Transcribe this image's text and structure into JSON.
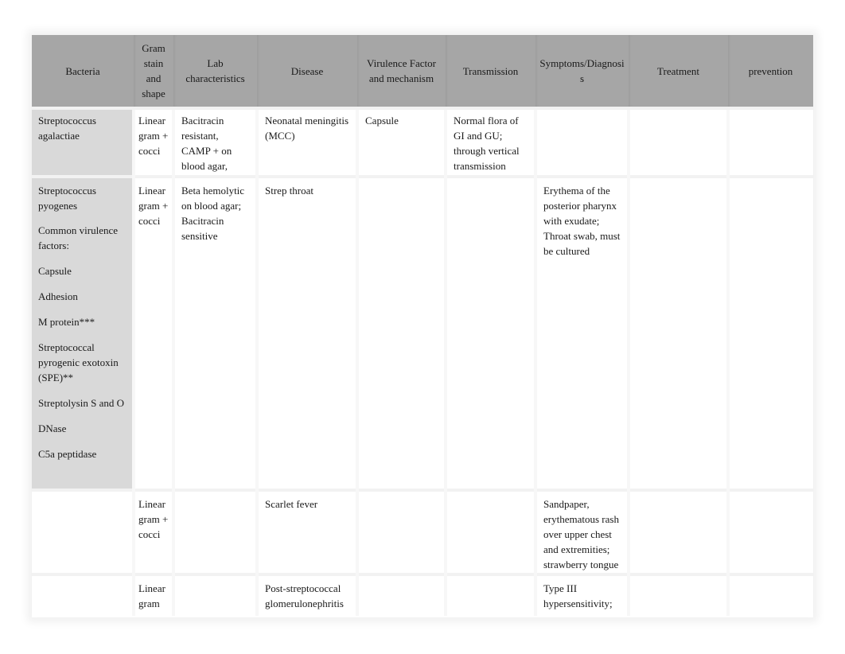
{
  "table": {
    "headers": [
      "Bacteria",
      "Gram stain and shape",
      "Lab characteristics",
      "Disease",
      "Virulence Factor and mechanism",
      "Transmission",
      "Symptoms/Diagnosis",
      "Treatment",
      "prevention"
    ],
    "rows": [
      {
        "bacteria": "Streptococcus agalactiae",
        "gram": "Linear gram + cocci",
        "lab": "Bacitracin resistant, CAMP + on blood agar,",
        "disease": "Neonatal meningitis (MCC)",
        "virulence": "Capsule",
        "transmission": "Normal flora of GI and GU; through vertical transmission",
        "symptoms": "",
        "treatment": "",
        "prevention": ""
      },
      {
        "bacteria": "Streptococcus pyogenes",
        "bacteria_notes": {
          "heading": "Common virulence factors:",
          "items": [
            "Capsule",
            "Adhesion",
            "M protein***",
            "Streptococcal pyrogenic exotoxin (SPE)**",
            "Streptolysin S and O",
            "DNase",
            "C5a peptidase"
          ]
        },
        "gram": "Linear gram + cocci",
        "lab": "Beta hemolytic on blood agar; Bacitracin sensitive",
        "disease": "Strep throat",
        "virulence": "",
        "transmission": "",
        "symptoms": "Erythema of the posterior pharynx with exudate; Throat swab, must be cultured",
        "treatment": "",
        "prevention": ""
      },
      {
        "bacteria": "",
        "gram": "Linear gram + cocci",
        "lab": "",
        "disease": "Scarlet fever",
        "virulence": "",
        "transmission": "",
        "symptoms": "Sandpaper, erythematous rash over upper chest and extremities; strawberry tongue",
        "treatment": "",
        "prevention": ""
      },
      {
        "bacteria": "",
        "gram": "Linear gram",
        "lab": "",
        "disease": "Post-streptococcal glomerulonephritis",
        "virulence": "",
        "transmission": "",
        "symptoms": "Type III hypersensitivity;",
        "treatment": "",
        "prevention": ""
      }
    ]
  }
}
